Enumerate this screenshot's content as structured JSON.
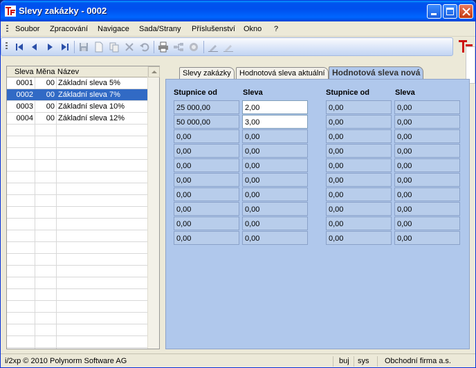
{
  "window": {
    "title": "Slevy zakázky - 0002"
  },
  "menu": [
    "Soubor",
    "Zpracování",
    "Navigace",
    "Sada/Strany",
    "Příslušenství",
    "Okno",
    "?"
  ],
  "list": {
    "headers": [
      "Sleva",
      "Měna",
      "Název"
    ],
    "rows": [
      {
        "code": "0001",
        "currency": "00",
        "name": "Základní sleva 5%"
      },
      {
        "code": "0002",
        "currency": "00",
        "name": "Základní sleva 7%"
      },
      {
        "code": "0003",
        "currency": "00",
        "name": "Základní sleva 10%"
      },
      {
        "code": "0004",
        "currency": "00",
        "name": "Základní sleva 12%"
      }
    ]
  },
  "tabs": [
    "Slevy zakázky",
    "Hodnotová sleva aktuální",
    "Hodnotová sleva nová"
  ],
  "grid": {
    "headers": [
      "Stupnice od",
      "Sleva",
      "Stupnice od",
      "Sleva"
    ],
    "left_rows": [
      [
        "25 000,00",
        "2,00"
      ],
      [
        "50 000,00",
        "3,00"
      ],
      [
        "0,00",
        "0,00"
      ],
      [
        "0,00",
        "0,00"
      ],
      [
        "0,00",
        "0,00"
      ],
      [
        "0,00",
        "0,00"
      ],
      [
        "0,00",
        "0,00"
      ],
      [
        "0,00",
        "0,00"
      ],
      [
        "0,00",
        "0,00"
      ],
      [
        "0,00",
        "0,00"
      ]
    ],
    "right_rows": [
      [
        "0,00",
        "0,00"
      ],
      [
        "0,00",
        "0,00"
      ],
      [
        "0,00",
        "0,00"
      ],
      [
        "0,00",
        "0,00"
      ],
      [
        "0,00",
        "0,00"
      ],
      [
        "0,00",
        "0,00"
      ],
      [
        "0,00",
        "0,00"
      ],
      [
        "0,00",
        "0,00"
      ],
      [
        "0,00",
        "0,00"
      ],
      [
        "0,00",
        "0,00"
      ]
    ]
  },
  "status": {
    "left": "i/2xp © 2010 Polynorm Software AG",
    "user": "buj",
    "system": "sys",
    "company": "Obchodní firma a.s."
  },
  "colors": {
    "selection": "#316ac5",
    "panel": "#b0c8ec",
    "titlebar": "#0053ee"
  },
  "icons": [
    "first-record-icon",
    "prev-record-icon",
    "next-record-icon",
    "last-record-icon",
    "save-icon",
    "new-icon",
    "copy-icon",
    "delete-icon",
    "undo-icon",
    "print-icon",
    "tree-icon",
    "stop-icon",
    "edit-icon",
    "edit-alt-icon",
    "app-logo-icon"
  ]
}
